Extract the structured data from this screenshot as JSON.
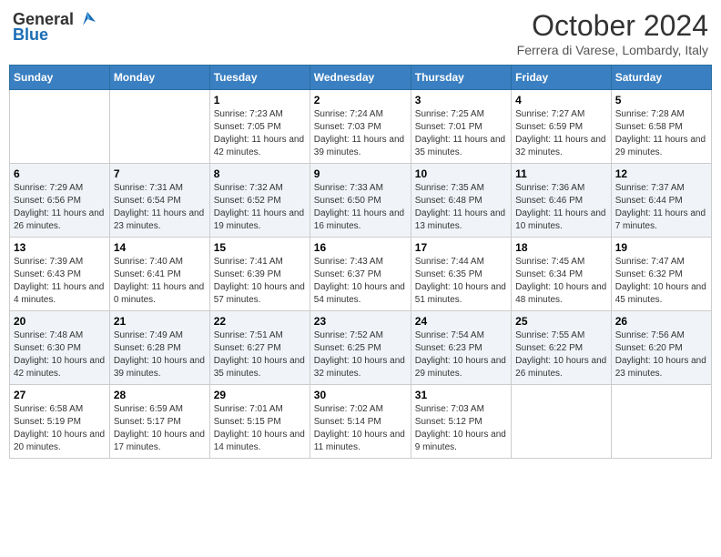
{
  "logo": {
    "general": "General",
    "blue": "Blue"
  },
  "title": "October 2024",
  "location": "Ferrera di Varese, Lombardy, Italy",
  "weekdays": [
    "Sunday",
    "Monday",
    "Tuesday",
    "Wednesday",
    "Thursday",
    "Friday",
    "Saturday"
  ],
  "weeks": [
    [
      {
        "day": "",
        "info": ""
      },
      {
        "day": "",
        "info": ""
      },
      {
        "day": "1",
        "info": "Sunrise: 7:23 AM\nSunset: 7:05 PM\nDaylight: 11 hours and 42 minutes."
      },
      {
        "day": "2",
        "info": "Sunrise: 7:24 AM\nSunset: 7:03 PM\nDaylight: 11 hours and 39 minutes."
      },
      {
        "day": "3",
        "info": "Sunrise: 7:25 AM\nSunset: 7:01 PM\nDaylight: 11 hours and 35 minutes."
      },
      {
        "day": "4",
        "info": "Sunrise: 7:27 AM\nSunset: 6:59 PM\nDaylight: 11 hours and 32 minutes."
      },
      {
        "day": "5",
        "info": "Sunrise: 7:28 AM\nSunset: 6:58 PM\nDaylight: 11 hours and 29 minutes."
      }
    ],
    [
      {
        "day": "6",
        "info": "Sunrise: 7:29 AM\nSunset: 6:56 PM\nDaylight: 11 hours and 26 minutes."
      },
      {
        "day": "7",
        "info": "Sunrise: 7:31 AM\nSunset: 6:54 PM\nDaylight: 11 hours and 23 minutes."
      },
      {
        "day": "8",
        "info": "Sunrise: 7:32 AM\nSunset: 6:52 PM\nDaylight: 11 hours and 19 minutes."
      },
      {
        "day": "9",
        "info": "Sunrise: 7:33 AM\nSunset: 6:50 PM\nDaylight: 11 hours and 16 minutes."
      },
      {
        "day": "10",
        "info": "Sunrise: 7:35 AM\nSunset: 6:48 PM\nDaylight: 11 hours and 13 minutes."
      },
      {
        "day": "11",
        "info": "Sunrise: 7:36 AM\nSunset: 6:46 PM\nDaylight: 11 hours and 10 minutes."
      },
      {
        "day": "12",
        "info": "Sunrise: 7:37 AM\nSunset: 6:44 PM\nDaylight: 11 hours and 7 minutes."
      }
    ],
    [
      {
        "day": "13",
        "info": "Sunrise: 7:39 AM\nSunset: 6:43 PM\nDaylight: 11 hours and 4 minutes."
      },
      {
        "day": "14",
        "info": "Sunrise: 7:40 AM\nSunset: 6:41 PM\nDaylight: 11 hours and 0 minutes."
      },
      {
        "day": "15",
        "info": "Sunrise: 7:41 AM\nSunset: 6:39 PM\nDaylight: 10 hours and 57 minutes."
      },
      {
        "day": "16",
        "info": "Sunrise: 7:43 AM\nSunset: 6:37 PM\nDaylight: 10 hours and 54 minutes."
      },
      {
        "day": "17",
        "info": "Sunrise: 7:44 AM\nSunset: 6:35 PM\nDaylight: 10 hours and 51 minutes."
      },
      {
        "day": "18",
        "info": "Sunrise: 7:45 AM\nSunset: 6:34 PM\nDaylight: 10 hours and 48 minutes."
      },
      {
        "day": "19",
        "info": "Sunrise: 7:47 AM\nSunset: 6:32 PM\nDaylight: 10 hours and 45 minutes."
      }
    ],
    [
      {
        "day": "20",
        "info": "Sunrise: 7:48 AM\nSunset: 6:30 PM\nDaylight: 10 hours and 42 minutes."
      },
      {
        "day": "21",
        "info": "Sunrise: 7:49 AM\nSunset: 6:28 PM\nDaylight: 10 hours and 39 minutes."
      },
      {
        "day": "22",
        "info": "Sunrise: 7:51 AM\nSunset: 6:27 PM\nDaylight: 10 hours and 35 minutes."
      },
      {
        "day": "23",
        "info": "Sunrise: 7:52 AM\nSunset: 6:25 PM\nDaylight: 10 hours and 32 minutes."
      },
      {
        "day": "24",
        "info": "Sunrise: 7:54 AM\nSunset: 6:23 PM\nDaylight: 10 hours and 29 minutes."
      },
      {
        "day": "25",
        "info": "Sunrise: 7:55 AM\nSunset: 6:22 PM\nDaylight: 10 hours and 26 minutes."
      },
      {
        "day": "26",
        "info": "Sunrise: 7:56 AM\nSunset: 6:20 PM\nDaylight: 10 hours and 23 minutes."
      }
    ],
    [
      {
        "day": "27",
        "info": "Sunrise: 6:58 AM\nSunset: 5:19 PM\nDaylight: 10 hours and 20 minutes."
      },
      {
        "day": "28",
        "info": "Sunrise: 6:59 AM\nSunset: 5:17 PM\nDaylight: 10 hours and 17 minutes."
      },
      {
        "day": "29",
        "info": "Sunrise: 7:01 AM\nSunset: 5:15 PM\nDaylight: 10 hours and 14 minutes."
      },
      {
        "day": "30",
        "info": "Sunrise: 7:02 AM\nSunset: 5:14 PM\nDaylight: 10 hours and 11 minutes."
      },
      {
        "day": "31",
        "info": "Sunrise: 7:03 AM\nSunset: 5:12 PM\nDaylight: 10 hours and 9 minutes."
      },
      {
        "day": "",
        "info": ""
      },
      {
        "day": "",
        "info": ""
      }
    ]
  ]
}
